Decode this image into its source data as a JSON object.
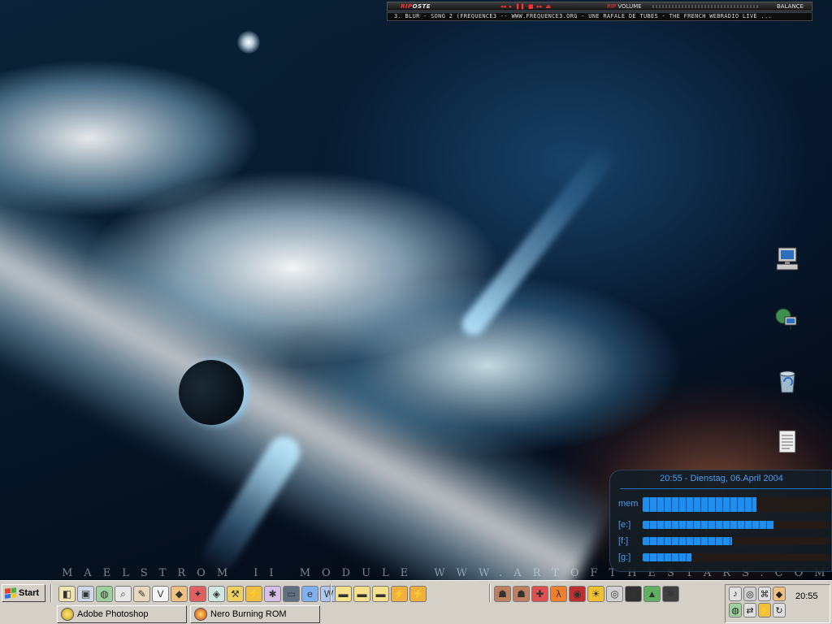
{
  "player": {
    "logo_rip": "RIP",
    "logo_rest": "OSTE",
    "controls": [
      "◂◂",
      "▸",
      "❚❚",
      "■",
      "▸▸",
      "⏏"
    ],
    "volume_label_rip": "RIP",
    "volume_label": "VOLUME",
    "balance_label": "BALANCE",
    "now_playing": "3. BLUR - SONG 2 (FREQUENCE3 -- WWW.FREQUENCE3.ORG - UNE RAFALE DE TUBES - THE FRENCH WEBRADIO LIVE ..."
  },
  "wallpaper": {
    "text": "MAELSTROM II MODULE  WWW.ARTOFTHESTARS.COM"
  },
  "desktop_icons": [
    {
      "name": "computer-icon"
    },
    {
      "name": "network-icon"
    },
    {
      "name": "recycle-bin-icon"
    },
    {
      "name": "notepad-icon"
    }
  ],
  "monitor": {
    "datetime": "20:55 - Dienstag, 06.April 2004",
    "rows": [
      {
        "label": "mem",
        "fill": 0.61
      },
      {
        "label": "[e:]",
        "fill": 0.7
      },
      {
        "label": "[f:]",
        "fill": 0.48
      },
      {
        "label": "[g:]",
        "fill": 0.26
      }
    ]
  },
  "taskbar": {
    "start_label": "Start",
    "quicklaunch_group1": [
      "show-desktop-icon",
      "my-computer-icon",
      "network-icon",
      "search-icon",
      "brush-icon",
      "vbasic-icon",
      "app-icon",
      "acrobat-icon",
      "dreamweaver-icon",
      "tool-icon",
      "flash-icon",
      "fireworks-icon",
      "terminal-icon",
      "ie-icon",
      "word-icon"
    ],
    "quicklaunch_group2": [
      "folder-icon",
      "folder-icon",
      "folder-icon",
      "winamp-icon",
      "winamp-icon"
    ],
    "quicklaunch_group3": [
      "game-icon",
      "game-icon",
      "cross-icon",
      "half-life-icon",
      "quake-icon",
      "sun-icon",
      "disc-icon",
      "aim-icon",
      "sierra-icon",
      "paw-icon"
    ],
    "tasks": [
      {
        "label": "Adobe Photoshop"
      },
      {
        "label": "Nero Burning ROM"
      }
    ],
    "tray_icons": [
      "speaker-icon",
      "disc-icon",
      "usb-icon",
      "app-icon",
      "network-icon",
      "connection-icon",
      "flash-icon",
      "update-icon"
    ],
    "clock": "20:55"
  },
  "colors": {
    "monitor_accent": "#4a9cf0",
    "monitor_bar": "#1e8ff0",
    "taskbar_bg": "#d4d0c8",
    "player_accent": "#ff3030"
  }
}
